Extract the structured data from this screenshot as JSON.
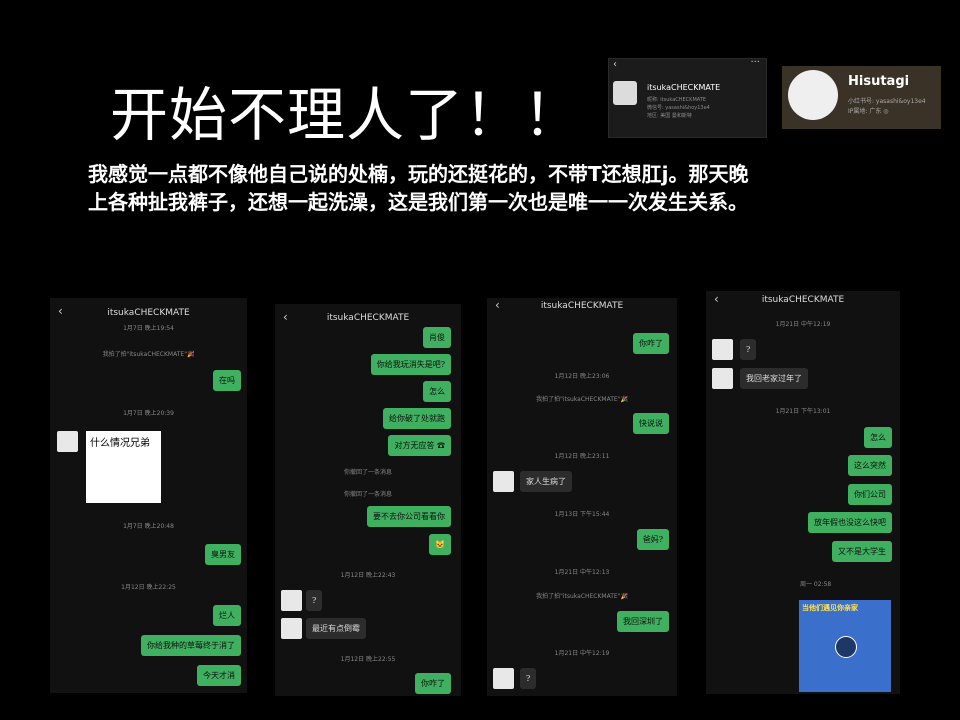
{
  "title": "开始不理人了！！",
  "paragraph": {
    "line1": "我感觉一点都不像他自己说的处楠，玩的还挺花的，不带T还想肛j。那天晚",
    "line2": "上各种扯我裤子，还想一起洗澡，这是我们第一次也是唯一一次发生关系。"
  },
  "profile1": {
    "name": "itsukaCHECKMATE",
    "lines": [
      "昵称: itsukaCHECKMATE",
      "微信号: yasashi&hoy13e4",
      "地区: 美国 曼和斯特"
    ]
  },
  "profile2": {
    "name": "Hisutagi",
    "lines": [
      "小红书号: yasashi&oy13e4",
      "IP属地: 广东 ◎"
    ]
  },
  "phone1": {
    "header": "itsukaCHECKMATE",
    "timestamps": [
      "1月7日 晚上19:54",
      "我拍了拍\"itsukaCHECKMATE\"🎉",
      "1月7日 晚上20:39",
      "1月7日 晚上20:48",
      "1月12日 晚上22:25"
    ],
    "messages": [
      "在吗",
      "臭男友",
      "烂人",
      "你给我种的草莓终于消了",
      "今天才消"
    ],
    "sticker_text": "什么情况兄弟"
  },
  "phone2": {
    "header": "itsukaCHECKMATE",
    "messages": [
      "肖俊",
      "你给我玩消失是吧?",
      "怎么",
      "给你破了处就跑",
      "对方无应答 ☎",
      "要不去你公司看看你",
      "🐱",
      "?",
      "最近有点倒霉",
      "你咋了"
    ],
    "timestamps": [
      "你撤回了一条消息",
      "你撤回了一条消息",
      "1月12日 晚上22:43",
      "1月12日 晚上22:55"
    ]
  },
  "phone3": {
    "header": "itsukaCHECKMATE",
    "messages": [
      "你咋了",
      "快说说",
      "家人生病了",
      "爸妈?",
      "我回深圳了",
      "?"
    ],
    "timestamps": [
      "1月12日 晚上23:06",
      "我拍了拍\"itsukaCHECKMATE\"🎉",
      "1月12日 晚上23:11",
      "1月13日 下午15:44",
      "1月21日 中午12:13",
      "我拍了拍\"itsukaCHECKMATE\"🎉",
      "1月21日 中午12:19"
    ]
  },
  "phone4": {
    "header": "itsukaCHECKMATE",
    "timestamps": [
      "1月21日 中午12:19",
      "1月21日 下午13:01",
      "周一 02:58"
    ],
    "messages": [
      "?",
      "我回老家过年了",
      "怎么",
      "这么突然",
      "你们公司",
      "放年假也没这么快吧",
      "又不是大学生"
    ],
    "video_title": "当他们遇见你亲家"
  },
  "colors": {
    "bubble_green": "#3eb060",
    "bubble_dark": "#2c2c2c",
    "bg": "#000000"
  }
}
